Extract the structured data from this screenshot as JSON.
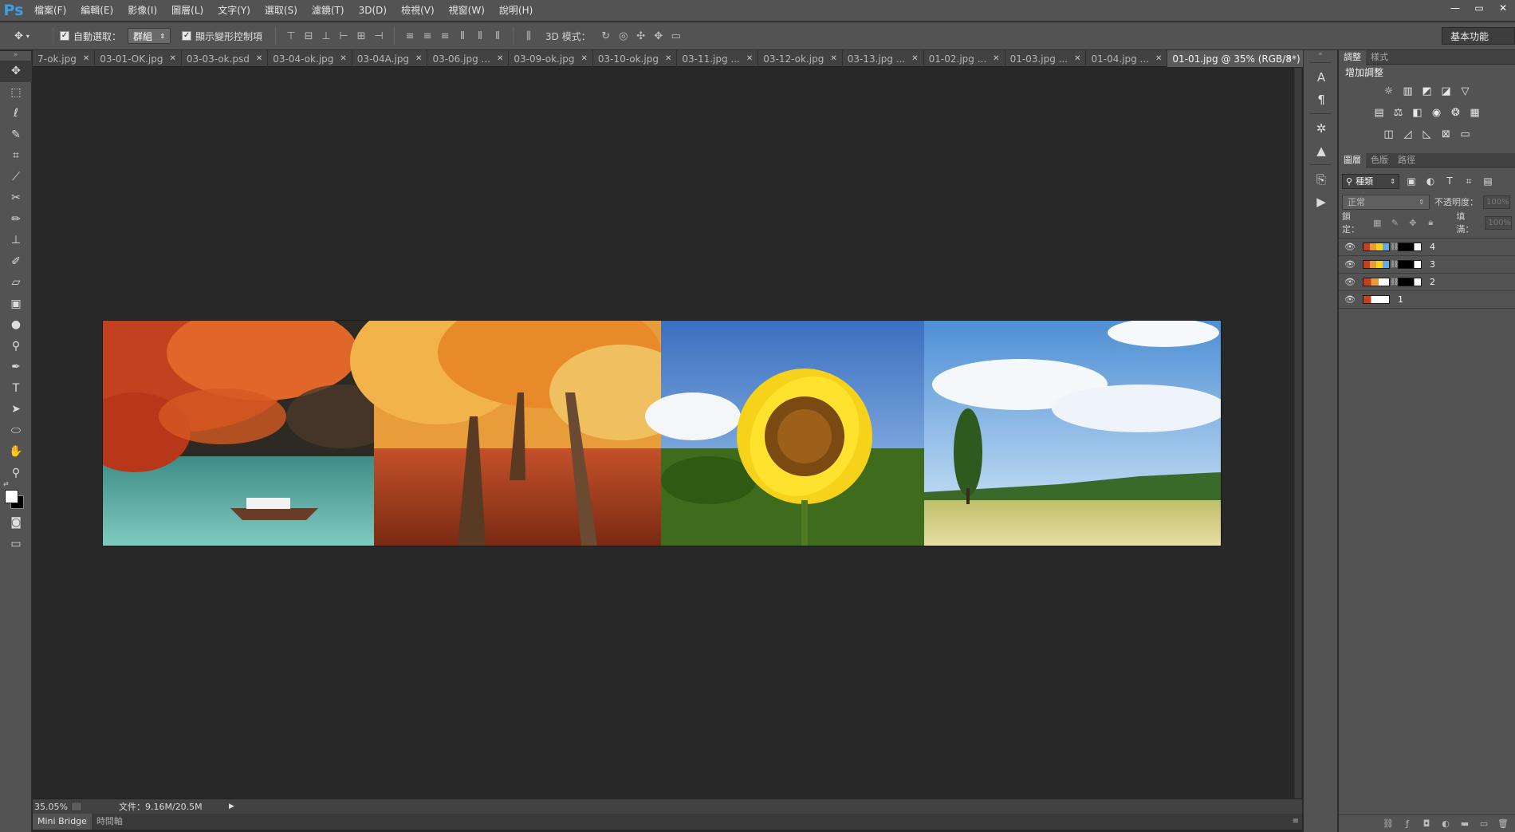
{
  "app": {
    "logo": "Ps"
  },
  "menu": [
    "檔案(F)",
    "編輯(E)",
    "影像(I)",
    "圖層(L)",
    "文字(Y)",
    "選取(S)",
    "濾鏡(T)",
    "3D(D)",
    "檢視(V)",
    "視窗(W)",
    "說明(H)"
  ],
  "window_controls": {
    "minimize": "—",
    "restore": "▭",
    "close": "✕"
  },
  "options": {
    "auto_select_label": "自動選取：",
    "auto_select_value": "群組",
    "show_transform_label": "顯示變形控制項",
    "mode3d_label": "3D 模式：",
    "workspace": "基本功能"
  },
  "tabs": [
    {
      "label": "7-ok.jpg",
      "active": false
    },
    {
      "label": "03-01-OK.jpg",
      "active": false
    },
    {
      "label": "03-03-ok.psd",
      "active": false
    },
    {
      "label": "03-04-ok.jpg",
      "active": false
    },
    {
      "label": "03-04A.jpg",
      "active": false
    },
    {
      "label": "03-06.jpg ...",
      "active": false
    },
    {
      "label": "03-09-ok.jpg",
      "active": false
    },
    {
      "label": "03-10-ok.jpg",
      "active": false
    },
    {
      "label": "03-11.jpg ...",
      "active": false
    },
    {
      "label": "03-12-ok.jpg",
      "active": false
    },
    {
      "label": "03-13.jpg ...",
      "active": false
    },
    {
      "label": "01-02.jpg ...",
      "active": false
    },
    {
      "label": "01-03.jpg ...",
      "active": false
    },
    {
      "label": "01-04.jpg ...",
      "active": false
    },
    {
      "label": "01-01.jpg @ 35% (RGB/8*) *",
      "active": true
    }
  ],
  "tabs_overflow": "»",
  "status": {
    "zoom": "35.05%",
    "doc_info": "文件：9.16M/20.5M"
  },
  "bottom_tabs": [
    "Mini Bridge",
    "時間軸"
  ],
  "adjust_panel": {
    "tabs": [
      "調整",
      "樣式"
    ],
    "title": "增加調整"
  },
  "layers_panel": {
    "tabs": [
      "圖層",
      "色版",
      "路徑"
    ],
    "kind": "種類",
    "blend_mode": "正常",
    "opacity_label": "不透明度：",
    "opacity_value": "100%",
    "lock_label": "鎖定：",
    "fill_label": "填滿：",
    "fill_value": "100%",
    "layers": [
      {
        "name": "4",
        "has_mask": true
      },
      {
        "name": "3",
        "has_mask": true
      },
      {
        "name": "2",
        "has_mask": true
      },
      {
        "name": "1",
        "has_mask": false
      }
    ]
  },
  "colors": {
    "accent": "#3a9fe8",
    "panel": "#535353",
    "canvas": "#282828"
  }
}
